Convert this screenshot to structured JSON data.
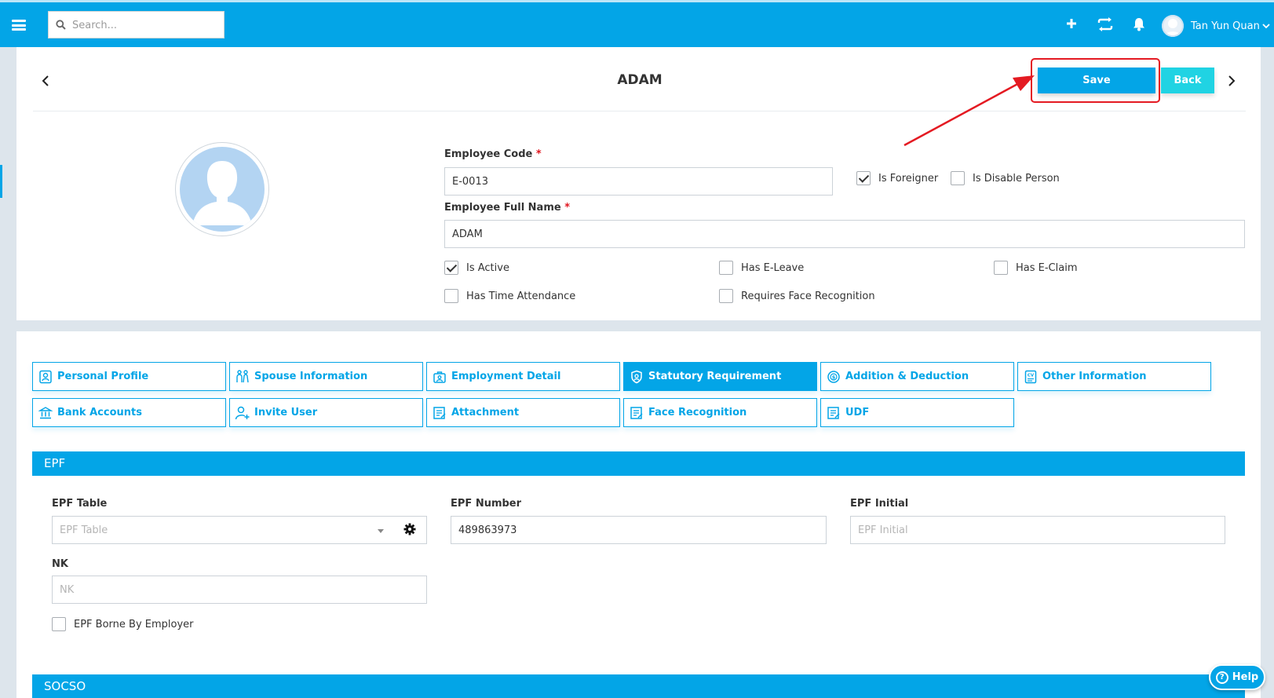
{
  "topbar": {
    "search_placeholder": "Search...",
    "user_name": "Tan Yun Quan"
  },
  "header": {
    "title": "ADAM",
    "save_label": "Save",
    "back_label": "Back"
  },
  "employee": {
    "code_label": "Employee Code",
    "code_value": "E-0013",
    "name_label": "Employee Full Name",
    "name_value": "ADAM",
    "required_mark": "*",
    "checkboxes": [
      {
        "label": "Is Foreigner",
        "checked": true
      },
      {
        "label": "Is Disable Person",
        "checked": false
      },
      {
        "label": "Is Active",
        "checked": true
      },
      {
        "label": "Has E-Leave",
        "checked": false
      },
      {
        "label": "Has E-Claim",
        "checked": false
      },
      {
        "label": "Has Time Attendance",
        "checked": false
      },
      {
        "label": "Requires Face Recognition",
        "checked": false
      }
    ]
  },
  "tabs": [
    {
      "label": "Personal Profile",
      "icon": "profile-card-icon",
      "active": false
    },
    {
      "label": "Spouse Information",
      "icon": "couple-icon",
      "active": false
    },
    {
      "label": "Employment Detail",
      "icon": "briefcase-icon",
      "active": false
    },
    {
      "label": "Statutory Requirement",
      "icon": "shield-icon",
      "active": true
    },
    {
      "label": "Addition & Deduction",
      "icon": "money-icon",
      "active": false
    },
    {
      "label": "Other Information",
      "icon": "cv-icon",
      "active": false
    },
    {
      "label": "Bank Accounts",
      "icon": "bank-icon",
      "active": false
    },
    {
      "label": "Invite User",
      "icon": "add-user-icon",
      "active": false
    },
    {
      "label": "Attachment",
      "icon": "document-icon",
      "active": false
    },
    {
      "label": "Face Recognition",
      "icon": "document-icon",
      "active": false
    },
    {
      "label": "UDF",
      "icon": "document-icon",
      "active": false
    }
  ],
  "epf": {
    "section_title": "EPF",
    "table_label": "EPF Table",
    "table_placeholder": "EPF Table",
    "number_label": "EPF Number",
    "number_value": "489863973",
    "initial_label": "EPF Initial",
    "initial_placeholder": "EPF Initial",
    "nk_label": "NK",
    "nk_placeholder": "NK",
    "borne_label": "EPF Borne By Employer",
    "borne_checked": false
  },
  "socso": {
    "section_title": "SOCSO"
  },
  "help_label": "Help",
  "colors": {
    "primary": "#03a5e7",
    "back_button": "#20d3e3",
    "highlight": "#e41a22"
  }
}
